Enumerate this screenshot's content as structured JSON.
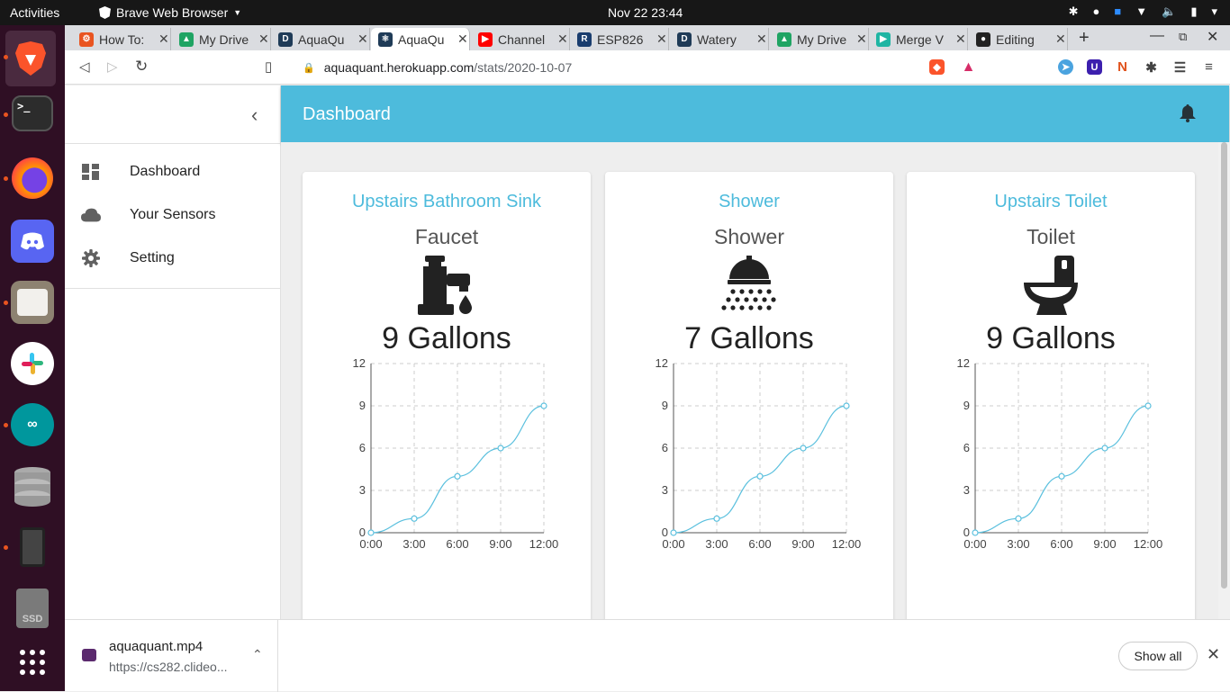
{
  "system": {
    "activities": "Activities",
    "app_name": "Brave Web Browser",
    "clock": "Nov 22  23:44"
  },
  "tabs": [
    {
      "title": "How To:",
      "favicon": "gear-favicon",
      "color": "#e95420"
    },
    {
      "title": "My Drive",
      "favicon": "drive-favicon",
      "color": "#1fa463"
    },
    {
      "title": "AquaQu",
      "favicon": "d-favicon",
      "color": "#1f3b57"
    },
    {
      "title": "AquaQu",
      "favicon": "react-favicon",
      "color": "#1f3b57",
      "active": true
    },
    {
      "title": "Channel",
      "favicon": "youtube-favicon",
      "color": "#ff0000"
    },
    {
      "title": "ESP826",
      "favicon": "r-favicon",
      "color": "#1a3d6e"
    },
    {
      "title": "Watery",
      "favicon": "d-favicon",
      "color": "#1f3b57"
    },
    {
      "title": "My Drive",
      "favicon": "drive-favicon",
      "color": "#1fa463"
    },
    {
      "title": "Merge V",
      "favicon": "play-favicon",
      "color": "#1fb5a3"
    },
    {
      "title": "Editing",
      "favicon": "github-favicon",
      "color": "#222222"
    }
  ],
  "url": {
    "domain": "aquaquant.herokuapp.com",
    "path": "/stats/2020-10-07"
  },
  "sidebar": {
    "items": [
      {
        "label": "Dashboard",
        "icon": "dashboard-icon"
      },
      {
        "label": "Your Sensors",
        "icon": "cloud-icon"
      },
      {
        "label": "Setting",
        "icon": "gear-icon"
      }
    ]
  },
  "header": {
    "title": "Dashboard"
  },
  "cards": [
    {
      "location": "Upstairs Bathroom Sink",
      "device": "Faucet",
      "icon": "faucet-icon",
      "usage": "9 Gallons"
    },
    {
      "location": "Shower",
      "device": "Shower",
      "icon": "shower-icon",
      "usage": "7 Gallons"
    },
    {
      "location": "Upstairs Toilet",
      "device": "Toilet",
      "icon": "toilet-icon",
      "usage": "9 Gallons"
    }
  ],
  "chart_data": [
    {
      "type": "line",
      "x": [
        "0:00",
        "3:00",
        "6:00",
        "9:00",
        "12:00"
      ],
      "series": [
        {
          "values": [
            0,
            1,
            4,
            6,
            9
          ]
        }
      ],
      "ylim": [
        0,
        12
      ],
      "yticks": [
        0,
        3,
        6,
        9,
        12
      ],
      "grid": true
    },
    {
      "type": "line",
      "x": [
        "0:00",
        "3:00",
        "6:00",
        "9:00",
        "12:00"
      ],
      "series": [
        {
          "values": [
            0,
            1,
            4,
            6,
            9
          ]
        }
      ],
      "ylim": [
        0,
        12
      ],
      "yticks": [
        0,
        3,
        6,
        9,
        12
      ],
      "grid": true
    },
    {
      "type": "line",
      "x": [
        "0:00",
        "3:00",
        "6:00",
        "9:00",
        "12:00"
      ],
      "series": [
        {
          "values": [
            0,
            1,
            4,
            6,
            9
          ]
        }
      ],
      "ylim": [
        0,
        12
      ],
      "yticks": [
        0,
        3,
        6,
        9,
        12
      ],
      "grid": true
    }
  ],
  "colors": {
    "accent": "#4dbbdc",
    "line": "#5bc0de"
  },
  "downloads": {
    "filename": "aquaquant.mp4",
    "url": "https://cs282.clideo...",
    "show_all": "Show all"
  }
}
